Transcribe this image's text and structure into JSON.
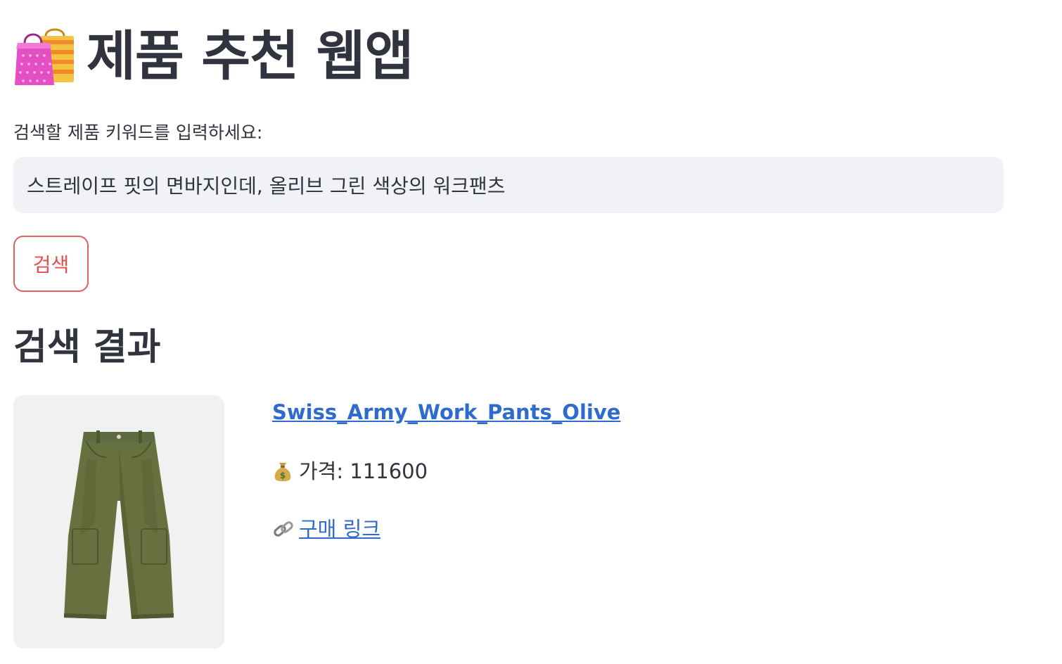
{
  "header": {
    "icon": "shopping-bags-icon",
    "title": "제품 추천 웹앱"
  },
  "search": {
    "label": "검색할 제품 키워드를 입력하세요:",
    "value": "스트레이프 핏의 면바지인데, 올리브 그린 색상의 워크팬츠",
    "button_label": "검색"
  },
  "results": {
    "heading": "검색 결과",
    "items": [
      {
        "name": "Swiss_Army_Work_Pants_Olive",
        "price_label": "가격: 111600",
        "price_icon": "money-bag-icon",
        "link_label": "구매 링크",
        "link_icon": "link-icon",
        "image": "olive-work-pants-photo"
      }
    ]
  },
  "colors": {
    "accent": "#e5514e",
    "link": "#2f6bcd",
    "text": "#31333f",
    "input_bg": "#f0f2f6"
  }
}
